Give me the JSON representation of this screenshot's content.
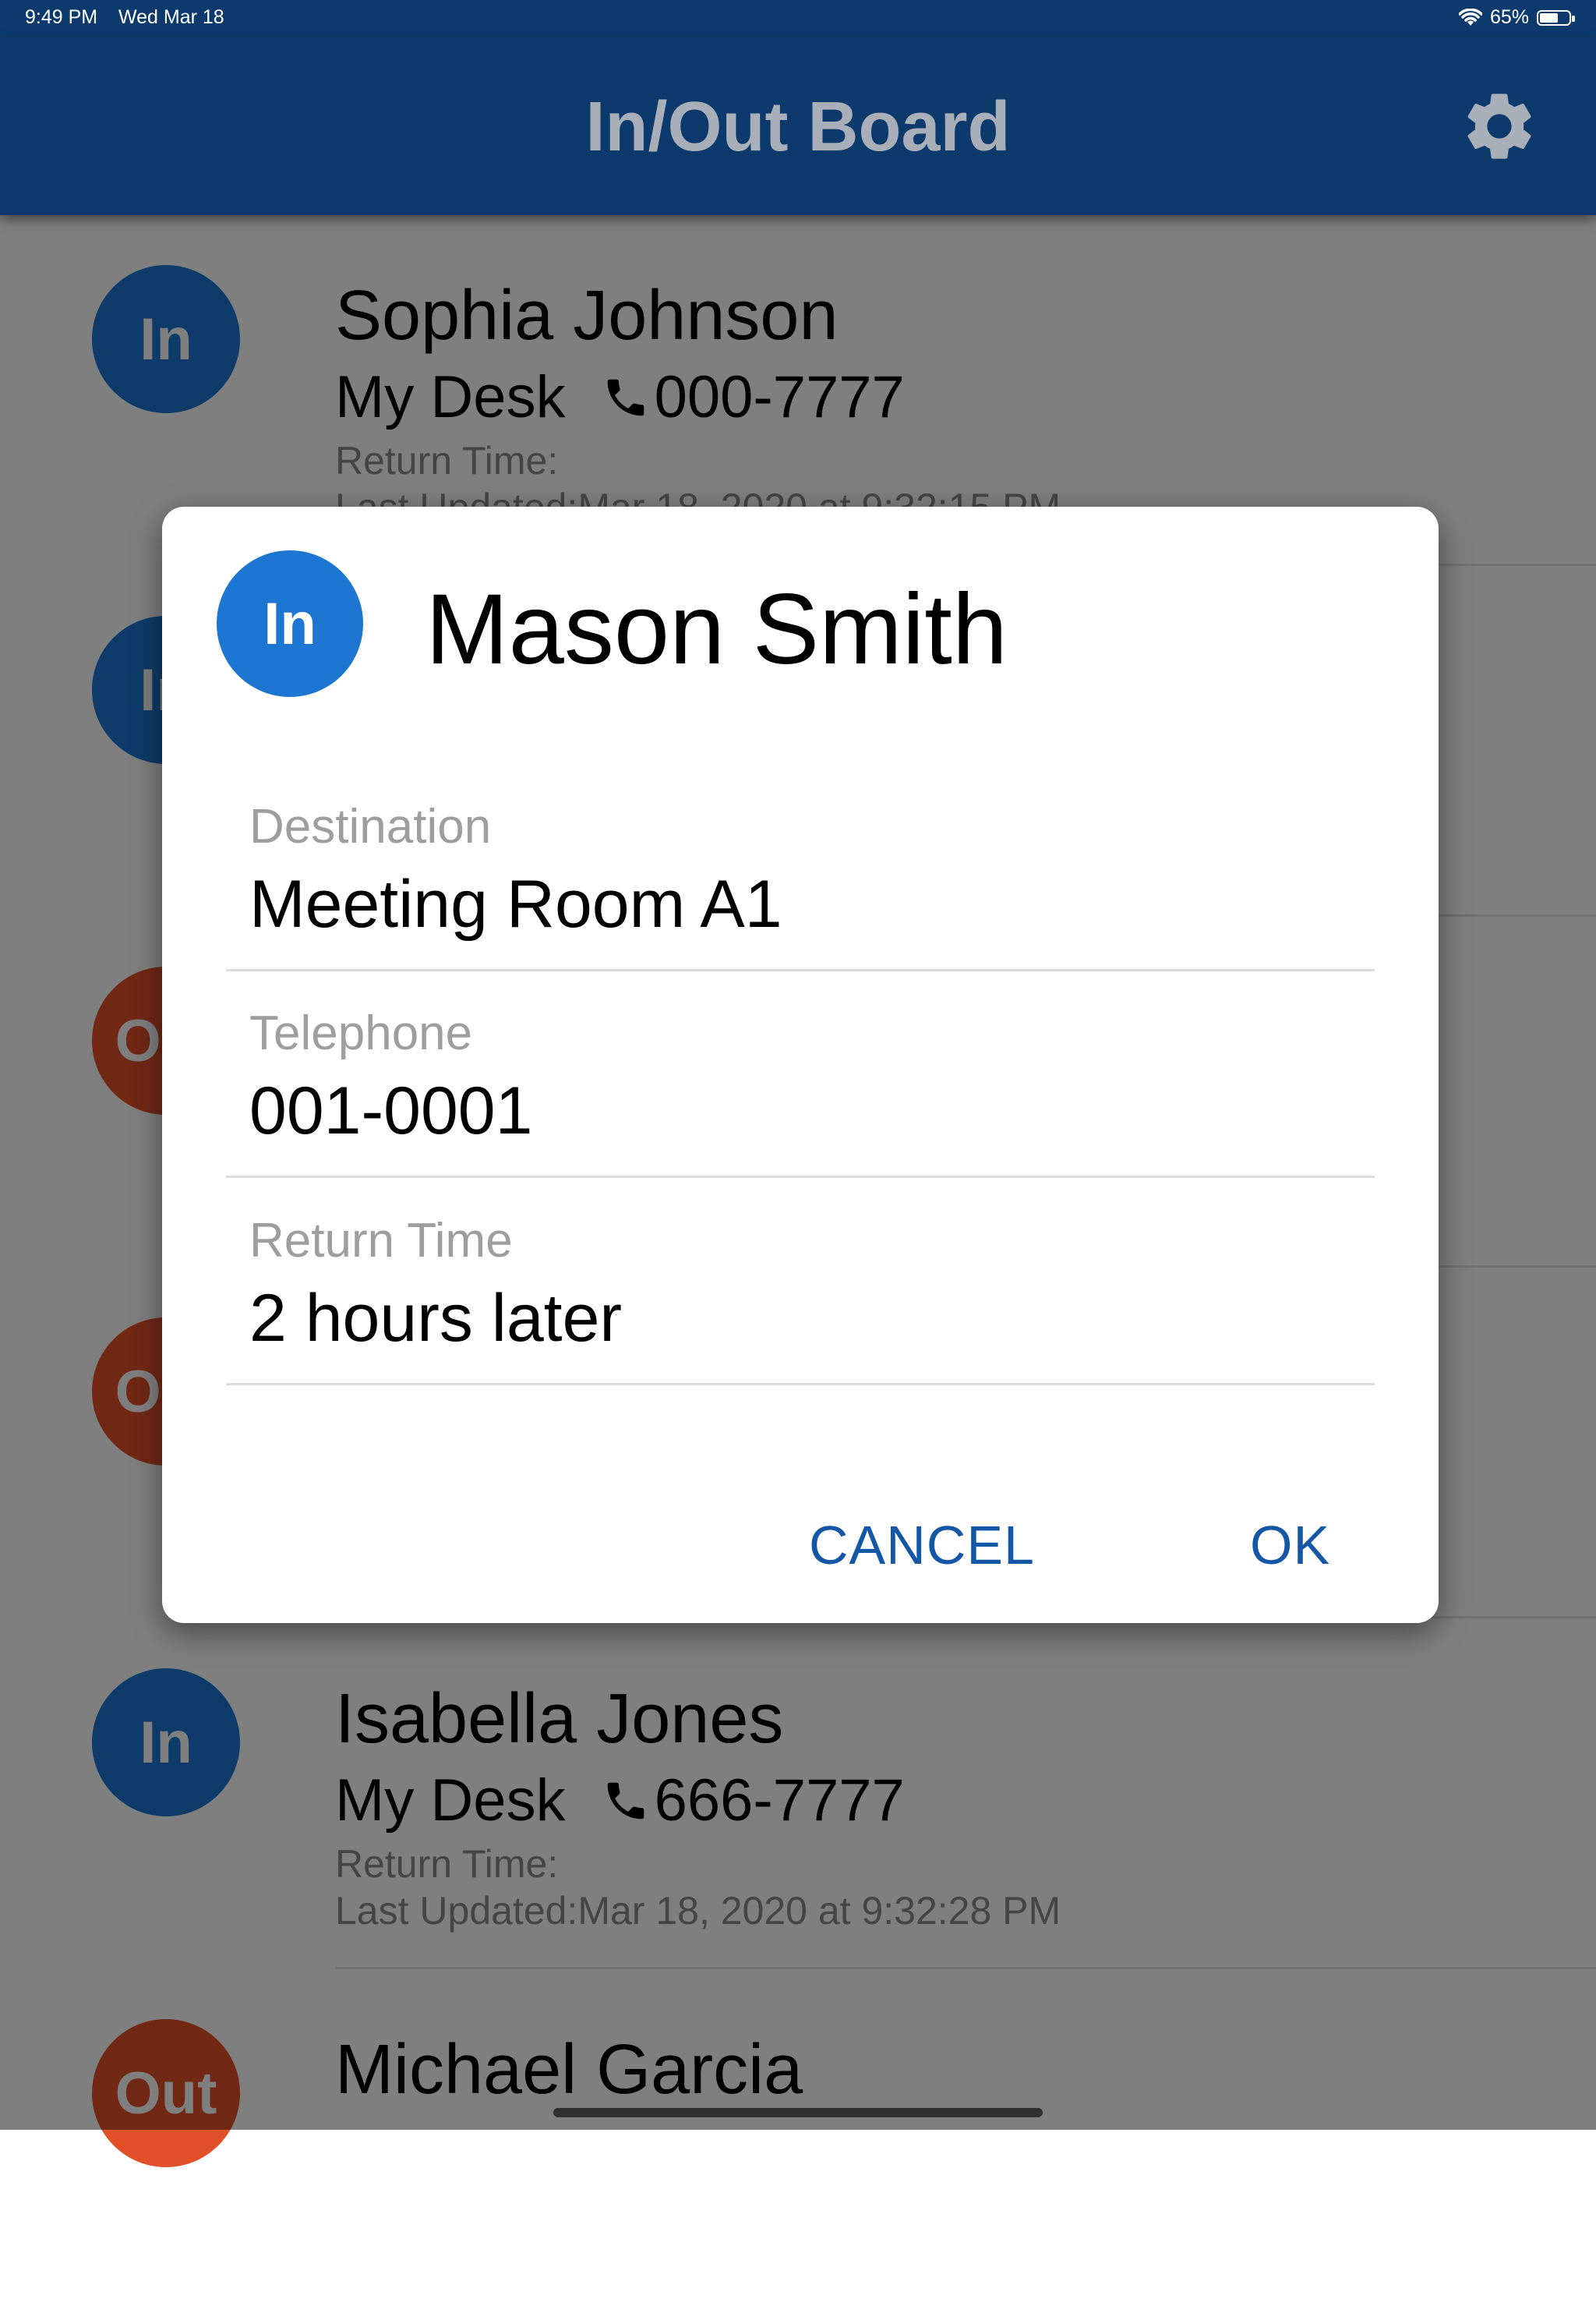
{
  "status_bar": {
    "time": "9:49 PM",
    "date": "Wed Mar 18",
    "battery": "65%",
    "battery_level": 0.65,
    "wifi_icon": "wifi-icon",
    "battery_icon": "battery-icon"
  },
  "app_bar": {
    "title": "In/Out Board",
    "settings_icon": "gear-icon"
  },
  "list": {
    "items": [
      {
        "badge": "In",
        "name": "Sophia Johnson",
        "location": "My Desk",
        "phone": "000-7777",
        "return_label": "Return Time:",
        "updated": "Last Updated:Mar 18, 2020 at 9:32:15 PM"
      },
      {
        "badge": "In",
        "name": "",
        "location": "",
        "phone": "",
        "return_label": "",
        "updated": ""
      },
      {
        "badge": "Out",
        "name": "",
        "location": "",
        "phone": "",
        "return_label": "",
        "updated": ""
      },
      {
        "badge": "Out",
        "name": "",
        "location": "",
        "phone": "",
        "return_label": "",
        "updated": ""
      },
      {
        "badge": "In",
        "name": "Isabella Jones",
        "location": "My Desk",
        "phone": "666-7777",
        "return_label": "Return Time:",
        "updated": "Last Updated:Mar 18, 2020 at 9:32:28 PM"
      },
      {
        "badge": "Out",
        "name": "Michael Garcia",
        "location": "",
        "phone": "",
        "return_label": "",
        "updated": ""
      }
    ]
  },
  "dialog": {
    "badge": "In",
    "name": "Mason Smith",
    "fields": [
      {
        "label": "Destination",
        "value": "Meeting Room A1"
      },
      {
        "label": "Telephone",
        "value": "001-0001"
      },
      {
        "label": "Return Time",
        "value": "2 hours later"
      }
    ],
    "cancel_label": "CANCEL",
    "ok_label": "OK"
  },
  "colors": {
    "app_bar": "#0d3a6c",
    "in_badge": "#1c76d2",
    "out_badge": "#e2502a",
    "button_text": "#1457a6"
  }
}
